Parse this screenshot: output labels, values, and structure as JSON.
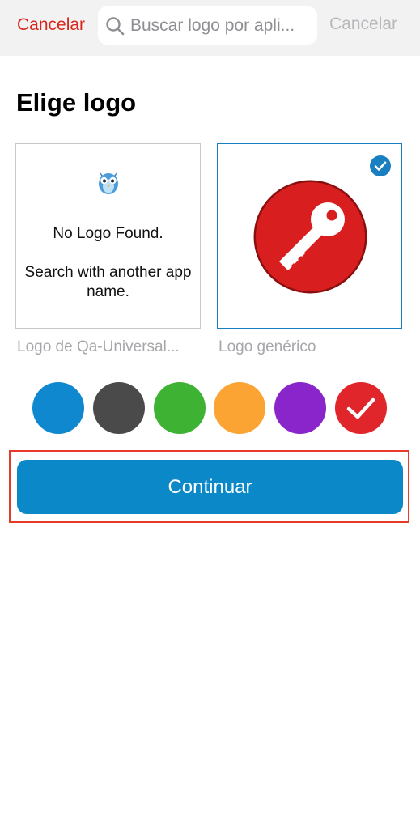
{
  "topbar": {
    "cancel_left": "Cancelar",
    "search_placeholder": "Buscar logo por apli...",
    "cancel_right": "Cancelar"
  },
  "heading": "Elige logo",
  "cards": {
    "left": {
      "message_line1": "No Logo Found.",
      "message_line2": "Search with another app name.",
      "caption": "Logo de Qa-Universal...",
      "icon": "owl-icon",
      "selected": false
    },
    "right": {
      "caption": "Logo genérico",
      "icon": "key-icon",
      "selected": true
    }
  },
  "swatches": [
    {
      "name": "blue",
      "color": "#1088d0",
      "selected": false
    },
    {
      "name": "dark-gray",
      "color": "#4a4a4a",
      "selected": false
    },
    {
      "name": "green",
      "color": "#3eb233",
      "selected": false
    },
    {
      "name": "orange",
      "color": "#fba333",
      "selected": false
    },
    {
      "name": "purple",
      "color": "#8a25cc",
      "selected": false
    },
    {
      "name": "red",
      "color": "#e0262b",
      "selected": true
    }
  ],
  "continue_label": "Continuar",
  "colors": {
    "accent_blue": "#0a88c7",
    "cancel_red": "#d9261c",
    "highlight_border": "#e63b2b",
    "key_red": "#d81e1e"
  }
}
